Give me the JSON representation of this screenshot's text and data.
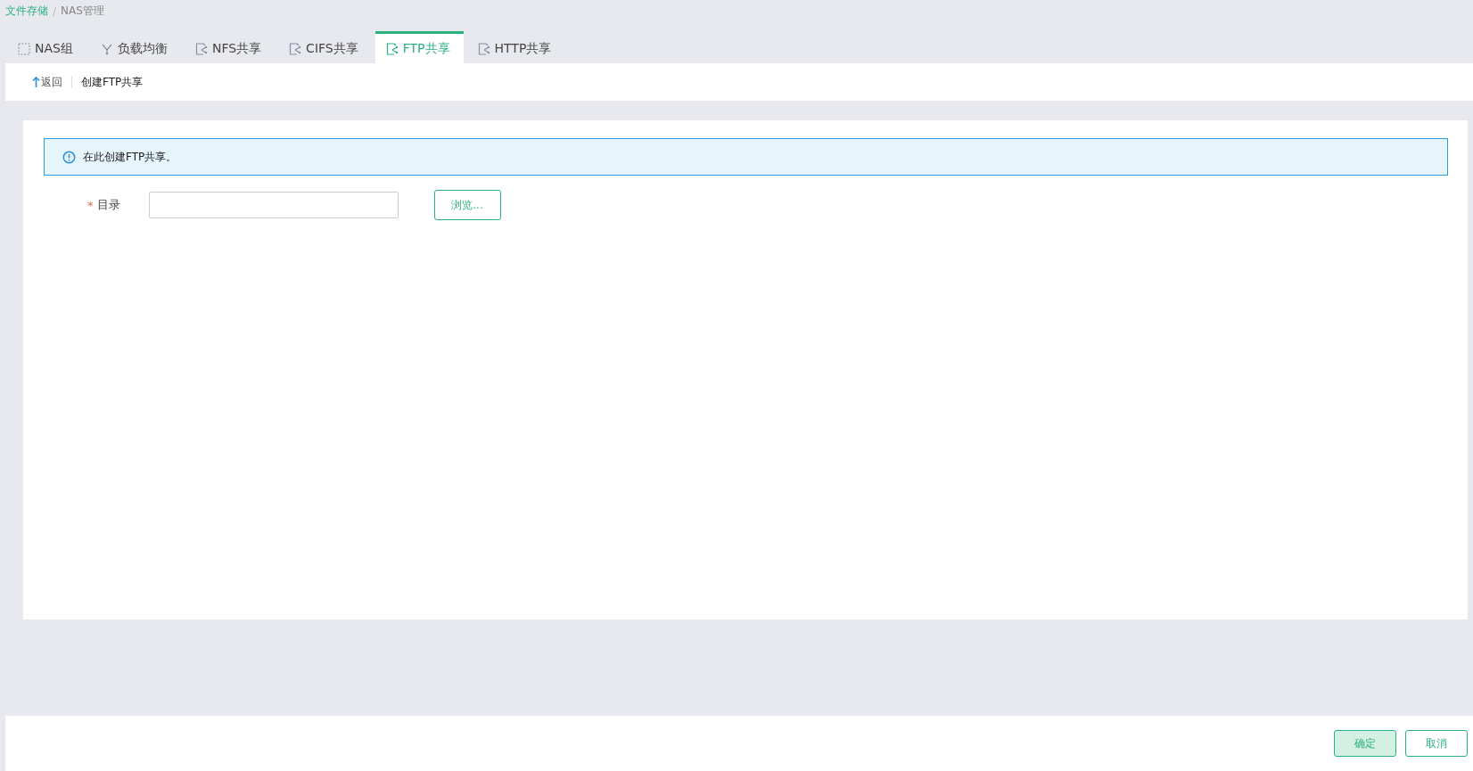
{
  "breadcrumb": [
    {
      "label": "文件存储",
      "link": true
    },
    {
      "label": "NAS管理",
      "link": false
    }
  ],
  "breadcrumb_separator": "/",
  "tabs": [
    {
      "label": "NAS组",
      "kind": "group",
      "selected": false
    },
    {
      "label": "负载均衡",
      "kind": "balance",
      "selected": false
    },
    {
      "label": "NFS共享",
      "kind": "share",
      "selected": false
    },
    {
      "label": "CIFS共享",
      "kind": "share",
      "selected": false
    },
    {
      "label": "FTP共享",
      "kind": "share",
      "selected": true
    },
    {
      "label": "HTTP共享",
      "kind": "share",
      "selected": false
    }
  ],
  "subheader": {
    "back": "返回",
    "title": "创建FTP共享"
  },
  "info": "在此创建FTP共享。",
  "form": {
    "required_mark": "*",
    "label": "目录",
    "browse": "浏览..."
  },
  "footer": {
    "confirm": "确定",
    "cancel": "取消"
  }
}
